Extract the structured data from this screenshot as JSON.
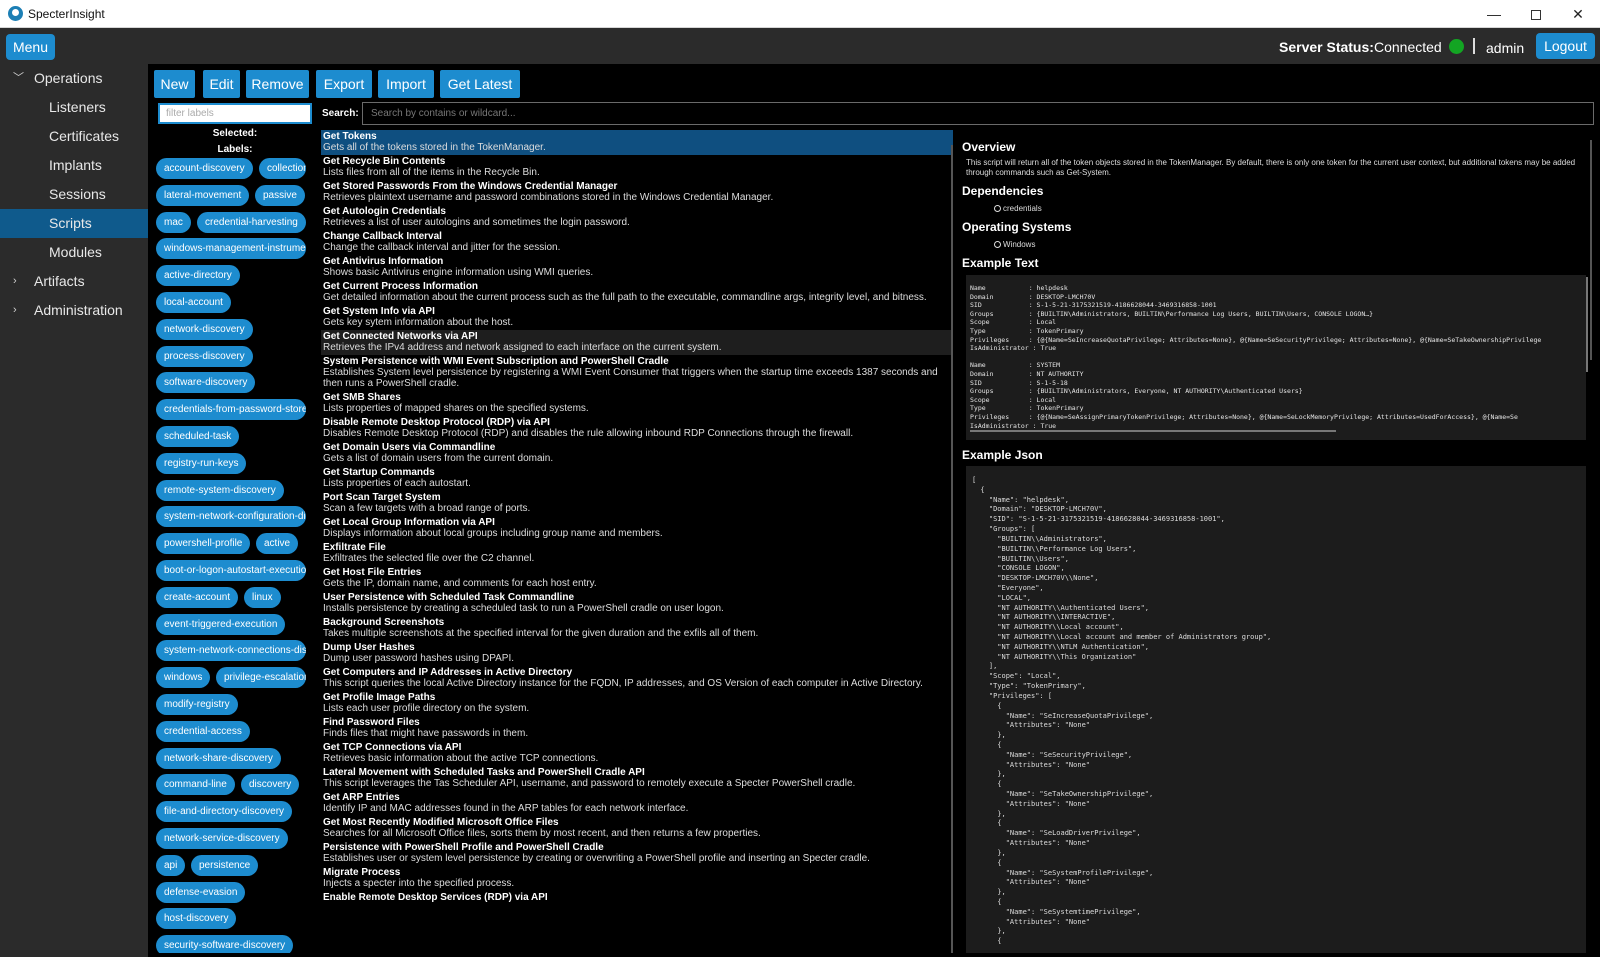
{
  "window": {
    "title": "SpecterInsight",
    "minimize": "—",
    "close": "✕"
  },
  "header": {
    "menu_label": "Menu",
    "server_status_label": "Server Status:",
    "server_status_value": "Connected",
    "status_color": "#13a523",
    "user": "admin",
    "logout_label": "Logout"
  },
  "sidebar": {
    "items": [
      {
        "label": "Operations",
        "caret": "﹀"
      },
      {
        "label": "Listeners"
      },
      {
        "label": "Certificates"
      },
      {
        "label": "Implants"
      },
      {
        "label": "Sessions"
      },
      {
        "label": "Scripts",
        "active": true
      },
      {
        "label": "Modules"
      },
      {
        "label": "Artifacts",
        "caret": "›"
      },
      {
        "label": "Administration",
        "caret": "›"
      }
    ]
  },
  "toolbar": {
    "new": "New",
    "edit": "Edit",
    "remove": "Remove",
    "export": "Export",
    "import": "Import",
    "get_latest": "Get Latest"
  },
  "labels_panel": {
    "filter_placeholder": "filter labels",
    "selected_label": "Selected:",
    "labels_label": "Labels:",
    "tags": [
      [
        "account-discovery",
        "collection"
      ],
      [
        "lateral-movement",
        "passive"
      ],
      [
        "mac",
        "credential-harvesting"
      ],
      [
        "windows-management-instrumentation"
      ],
      [
        "active-directory"
      ],
      [
        "local-account"
      ],
      [
        "network-discovery"
      ],
      [
        "process-discovery"
      ],
      [
        "software-discovery"
      ],
      [
        "credentials-from-password-stores"
      ],
      [
        "scheduled-task"
      ],
      [
        "registry-run-keys"
      ],
      [
        "remote-system-discovery"
      ],
      [
        "system-network-configuration-discovery"
      ],
      [
        "powershell-profile",
        "active"
      ],
      [
        "boot-or-logon-autostart-execution"
      ],
      [
        "create-account",
        "linux"
      ],
      [
        "event-triggered-execution"
      ],
      [
        "system-network-connections-discovery"
      ],
      [
        "windows",
        "privilege-escalation"
      ],
      [
        "modify-registry"
      ],
      [
        "credential-access"
      ],
      [
        "network-share-discovery"
      ],
      [
        "command-line",
        "discovery"
      ],
      [
        "file-and-directory-discovery"
      ],
      [
        "network-service-discovery"
      ],
      [
        "api",
        "persistence"
      ],
      [
        "defense-evasion"
      ],
      [
        "host-discovery"
      ],
      [
        "security-software-discovery"
      ]
    ]
  },
  "search": {
    "label": "Search:",
    "placeholder": "Search by contains or wildcard..."
  },
  "scripts": [
    {
      "name": "Get Tokens",
      "desc": "Gets all of the tokens stored in the TokenManager."
    },
    {
      "name": "Get Recycle Bin Contents",
      "desc": "Lists files from all of the items in the Recycle Bin."
    },
    {
      "name": "Get Stored Passwords From the Windows Credential Manager",
      "desc": "Retrieves plaintext username and password combinations stored in the Windows Credential Manager."
    },
    {
      "name": "Get Autologin Credentials",
      "desc": "Retrieves a list of user autologins and sometimes the login password."
    },
    {
      "name": "Change Callback Interval",
      "desc": "Change the callback interval and jitter for the session."
    },
    {
      "name": "Get Antivirus Information",
      "desc": "Shows basic Antivirus engine information using WMI queries."
    },
    {
      "name": "Get Current Process Information",
      "desc": "Get detailed information about the current process such as the full path to the executable, commandline args, integrity level, and bitness."
    },
    {
      "name": "Get System Info via API",
      "desc": "Gets key sytem information about the host."
    },
    {
      "name": "Get Connected Networks via API",
      "desc": "Retrieves the IPv4 address and network assigned to each interface on the current system."
    },
    {
      "name": "System Persistence with WMI Event Subscription and PowerShell Cradle",
      "desc": "Establishes System level persistence by registering a WMI Event Consumer that triggers when the startup time exceeds 1387 seconds and then runs a PowerShell cradle."
    },
    {
      "name": "Get SMB Shares",
      "desc": "Lists properties of mapped shares on the specified systems."
    },
    {
      "name": "Disable Remote Desktop Protocol (RDP) via API",
      "desc": "Disables Remote Desktop Protocol (RDP) and disables the rule allowing inbound RDP Connections through the firewall."
    },
    {
      "name": "Get Domain Users via Commandline",
      "desc": "Gets a list of domain users from the current domain."
    },
    {
      "name": "Get Startup Commands",
      "desc": "Lists properties of each autostart."
    },
    {
      "name": "Port Scan Target System",
      "desc": "Scan a few targets with a broad range of ports."
    },
    {
      "name": "Get Local Group Information via API",
      "desc": "Displays information about local groups including group name and members."
    },
    {
      "name": "Exfiltrate File",
      "desc": "Exfiltrates the selected file over the C2 channel."
    },
    {
      "name": "Get Host File Entries",
      "desc": "Gets the IP, domain name, and comments for each host entry."
    },
    {
      "name": "User Persistence with Scheduled Task Commandline",
      "desc": "Installs persistence by creating a scheduled task to run a PowerShell cradle on user logon."
    },
    {
      "name": "Background Screenshots",
      "desc": "Takes multiple screenshots at the specified interval for the given duration and the exfils all of them."
    },
    {
      "name": "Dump User Hashes",
      "desc": "Dump user password hashes using DPAPI."
    },
    {
      "name": "Get Computers and IP Addresses in Active Directory",
      "desc": "This script queries the local Active Directory instance for the FQDN, IP addresses, and OS Version of each computer in Active Directory."
    },
    {
      "name": "Get Profile Image Paths",
      "desc": "Lists each user profile directory on the system."
    },
    {
      "name": "Find Password Files",
      "desc": "Finds files that might have passwords in them."
    },
    {
      "name": "Get TCP Connections via API",
      "desc": "Retrieves basic information about the active TCP connections."
    },
    {
      "name": "Lateral Movement with Scheduled Tasks and PowerShell Cradle API",
      "desc": "This script leverages the Tas Scheduler API, username, and password to remotely execute a Specter PowerShell cradle."
    },
    {
      "name": "Get ARP Entries",
      "desc": "Identify IP and MAC addresses found in the ARP tables for each network interface."
    },
    {
      "name": "Get Most Recently Modified Microsoft Office Files",
      "desc": "Searches for all Microsoft Office files, sorts them by most recent, and then returns a few properties."
    },
    {
      "name": "Persistence with PowerShell Profile and PowerShell Cradle",
      "desc": "Establishes user or system level persistence by creating or overwriting a PowerShell profile and inserting an Specter cradle."
    },
    {
      "name": "Migrate Process",
      "desc": "Injects a specter into the specified process."
    },
    {
      "name": "Enable Remote Desktop Services (RDP) via API",
      "desc": ""
    }
  ],
  "details": {
    "overview_title": "Overview",
    "overview_text": "This script will return all of the token objects stored in the TokenManager. By default, there is only one token for the current user context, but additional tokens may be added through commands such as Get-System.",
    "dependencies_title": "Dependencies",
    "dependencies": [
      "credentials"
    ],
    "os_title": "Operating Systems",
    "os": [
      "Windows"
    ],
    "example_text_title": "Example Text",
    "example_text": "Name           : helpdesk\nDomain         : DESKTOP-LMCH70V\nSID            : S-1-5-21-3175321519-4186628044-3469316858-1001\nGroups         : {BUILTIN\\Administrators, BUILTIN\\Performance Log Users, BUILTIN\\Users, CONSOLE LOGON…}\nScope          : Local\nType           : TokenPrimary\nPrivileges     : {@{Name=SeIncreaseQuotaPrivilege; Attributes=None}, @{Name=SeSecurityPrivilege; Attributes=None}, @{Name=SeTakeOwnershipPrivilege\nIsAdministrator : True\n\nName           : SYSTEM\nDomain         : NT AUTHORITY\nSID            : S-1-5-18\nGroups         : {BUILTIN\\Administrators, Everyone, NT AUTHORITY\\Authenticated Users}\nScope          : Local\nType           : TokenPrimary\nPrivileges     : {@{Name=SeAssignPrimaryTokenPrivilege; Attributes=None}, @{Name=SeLockMemoryPrivilege; Attributes=UsedForAccess}, @{Name=Se\nIsAdministrator : True",
    "example_json_title": "Example Json",
    "example_json": "[\n  {\n    \"Name\": \"helpdesk\",\n    \"Domain\": \"DESKTOP-LMCH70V\",\n    \"SID\": \"S-1-5-21-3175321519-4186628044-3469316858-1001\",\n    \"Groups\": [\n      \"BUILTIN\\\\Administrators\",\n      \"BUILTIN\\\\Performance Log Users\",\n      \"BUILTIN\\\\Users\",\n      \"CONSOLE LOGON\",\n      \"DESKTOP-LMCH70V\\\\None\",\n      \"Everyone\",\n      \"LOCAL\",\n      \"NT AUTHORITY\\\\Authenticated Users\",\n      \"NT AUTHORITY\\\\INTERACTIVE\",\n      \"NT AUTHORITY\\\\Local account\",\n      \"NT AUTHORITY\\\\Local account and member of Administrators group\",\n      \"NT AUTHORITY\\\\NTLM Authentication\",\n      \"NT AUTHORITY\\\\This Organization\"\n    ],\n    \"Scope\": \"Local\",\n    \"Type\": \"TokenPrimary\",\n    \"Privileges\": [\n      {\n        \"Name\": \"SeIncreaseQuotaPrivilege\",\n        \"Attributes\": \"None\"\n      },\n      {\n        \"Name\": \"SeSecurityPrivilege\",\n        \"Attributes\": \"None\"\n      },\n      {\n        \"Name\": \"SeTakeOwnershipPrivilege\",\n        \"Attributes\": \"None\"\n      },\n      {\n        \"Name\": \"SeLoadDriverPrivilege\",\n        \"Attributes\": \"None\"\n      },\n      {\n        \"Name\": \"SeSystemProfilePrivilege\",\n        \"Attributes\": \"None\"\n      },\n      {\n        \"Name\": \"SeSystemtimePrivilege\",\n        \"Attributes\": \"None\"\n      },\n      {"
  },
  "colors": {
    "accent": "#1d8ccf",
    "selected_row": "#0f4f80",
    "sidebar_active": "#0f5a8c",
    "json_string": "#3fd43f"
  }
}
